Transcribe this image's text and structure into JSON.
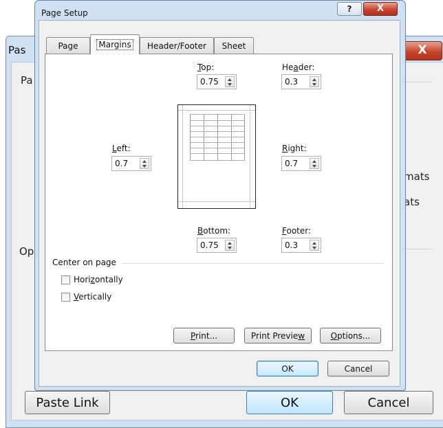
{
  "background_dialog": {
    "title": "Pas",
    "group_paste": "Pa",
    "group_operation": "Op",
    "text_formats_1": "mats",
    "text_formats_2": "ats",
    "paste_link_label": "Paste Link",
    "ok_label": "OK",
    "cancel_label": "Cancel",
    "close_glyph": "X"
  },
  "dialog": {
    "title": "Page Setup",
    "help_glyph": "?",
    "close_glyph": "X"
  },
  "tabs": [
    "Page",
    "Margins",
    "Header/Footer",
    "Sheet"
  ],
  "active_tab": "Margins",
  "margins": {
    "top": {
      "pre": "",
      "key": "T",
      "post": "op:",
      "value": "0.75"
    },
    "header": {
      "pre": "He",
      "key": "a",
      "post": "der:",
      "value": "0.3"
    },
    "left": {
      "pre": "",
      "key": "L",
      "post": "eft:",
      "value": "0.7"
    },
    "right": {
      "pre": "",
      "key": "R",
      "post": "ight:",
      "value": "0.7"
    },
    "bottom": {
      "pre": "",
      "key": "B",
      "post": "ottom:",
      "value": "0.75"
    },
    "footer": {
      "pre": "",
      "key": "F",
      "post": "ooter:",
      "value": "0.3"
    }
  },
  "center_on_page": {
    "label": "Center on page",
    "horizontally": {
      "pre": "Hori",
      "key": "z",
      "post": "ontally",
      "checked": false
    },
    "vertically": {
      "pre": "",
      "key": "V",
      "post": "ertically",
      "checked": false
    }
  },
  "buttons": {
    "print": {
      "pre": "",
      "key": "P",
      "post": "rint..."
    },
    "print_preview": {
      "pre": "Print Previe",
      "key": "w",
      "post": ""
    },
    "options": {
      "pre": "",
      "key": "O",
      "post": "ptions..."
    },
    "ok": "OK",
    "cancel": "Cancel"
  }
}
